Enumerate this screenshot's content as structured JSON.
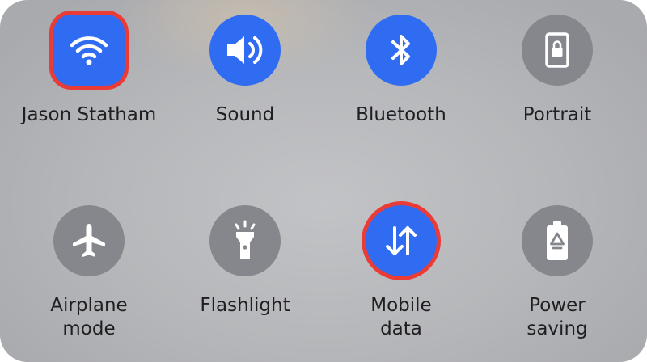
{
  "tiles": [
    {
      "label": "Jason Statham",
      "icon": "wifi-icon",
      "state": "on"
    },
    {
      "label": "Sound",
      "icon": "volume-icon",
      "state": "on"
    },
    {
      "label": "Bluetooth",
      "icon": "bluetooth-icon",
      "state": "on"
    },
    {
      "label": "Portrait",
      "icon": "rotation-lock-icon",
      "state": "off"
    },
    {
      "label": "Airplane\nmode",
      "icon": "airplane-icon",
      "state": "off"
    },
    {
      "label": "Flashlight",
      "icon": "flashlight-icon",
      "state": "off"
    },
    {
      "label": "Mobile\ndata",
      "icon": "mobile-data-icon",
      "state": "on"
    },
    {
      "label": "Power\nsaving",
      "icon": "power-saving-icon",
      "state": "off"
    }
  ],
  "colors": {
    "active": "#2f6cf2",
    "inactive": "#85878c",
    "highlight": "#ea3b37"
  }
}
